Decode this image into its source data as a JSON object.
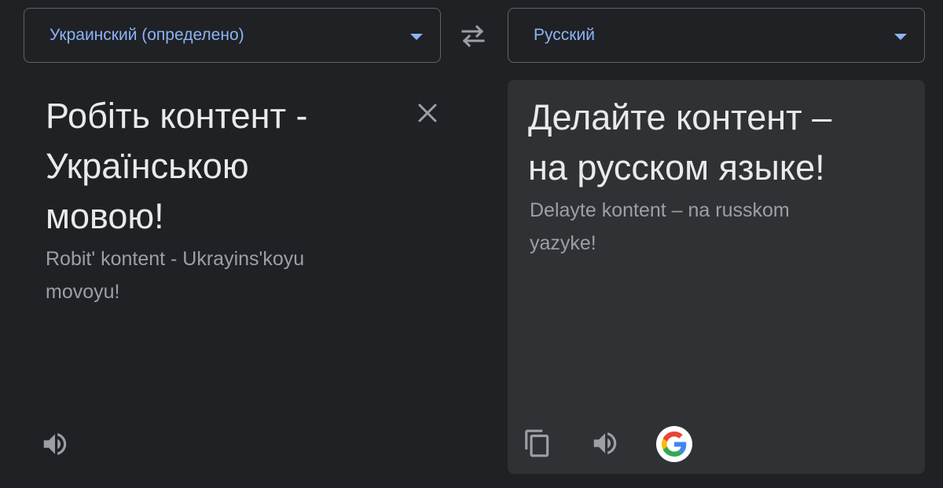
{
  "source_language": {
    "label": "Украинский (определено)"
  },
  "target_language": {
    "label": "Русский"
  },
  "source": {
    "text": "Робіть контент -\nУкраїнською\nмовою!",
    "transliteration": "Robit' kontent - Ukrayins'koyu\nmovoyu!"
  },
  "target": {
    "text": "Делайте контент –\nна русском языке!",
    "transliteration": "Delayte kontent – na russkom\nyazyke!"
  },
  "icons": {
    "swap": "swap-languages-icon",
    "close": "clear-text-icon",
    "source_speaker": "speaker-icon",
    "copy": "copy-icon",
    "target_speaker": "speaker-icon",
    "google": "google-logo-icon"
  },
  "colors": {
    "background": "#202124",
    "panel": "#303134",
    "accent": "#8ab4f8",
    "text": "#e8eaed",
    "muted": "#9aa0a6",
    "icon": "#9aa0a6"
  }
}
